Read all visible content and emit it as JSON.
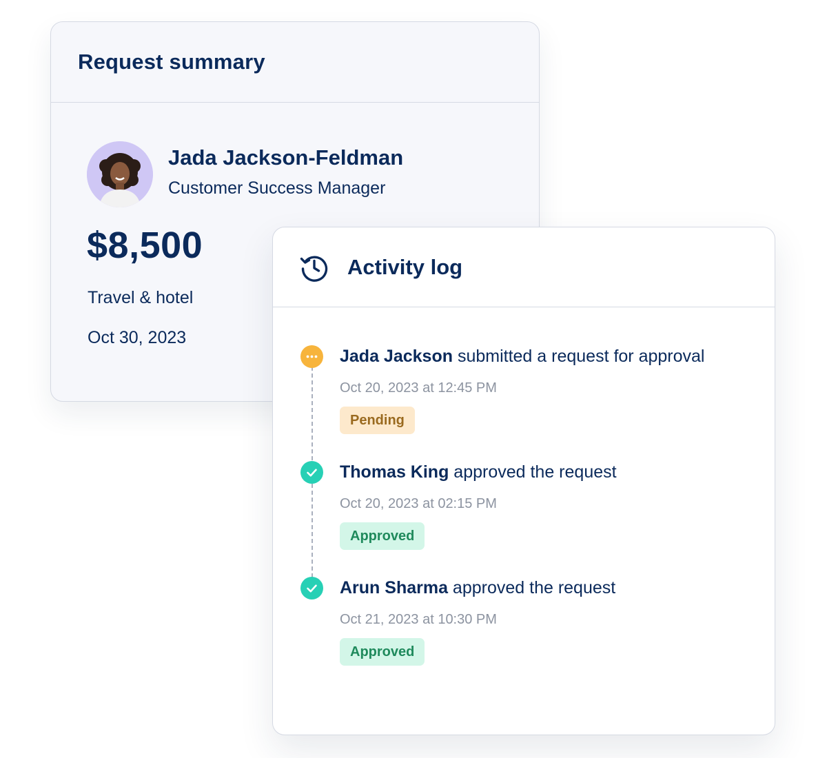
{
  "summary": {
    "title": "Request summary",
    "person_name": "Jada Jackson-Feldman",
    "person_role": "Customer Success Manager",
    "amount": "$8,500",
    "category": "Travel & hotel",
    "date": "Oct 30, 2023",
    "avatar_icon": "person-avatar"
  },
  "activity": {
    "title": "Activity log",
    "icon": "history-icon",
    "events": [
      {
        "actor": "Jada Jackson",
        "action": " submitted a request for approval",
        "time": "Oct 20, 2023 at 12:45 PM",
        "status": "Pending",
        "status_color": "#f7b43c"
      },
      {
        "actor": "Thomas King",
        "action": " approved the request",
        "time": "Oct 20, 2023 at 02:15 PM",
        "status": "Approved",
        "status_color": "#27d0b5"
      },
      {
        "actor": "Arun Sharma",
        "action": " approved the request",
        "time": "Oct 21, 2023 at 10:30 PM",
        "status": "Approved",
        "status_color": "#27d0b5"
      }
    ]
  },
  "colors": {
    "navy": "#0b2a5b",
    "pending_bg": "#fde9cc",
    "approved_bg": "#d3f6e8",
    "avatar_bg": "#cfc7f5"
  }
}
